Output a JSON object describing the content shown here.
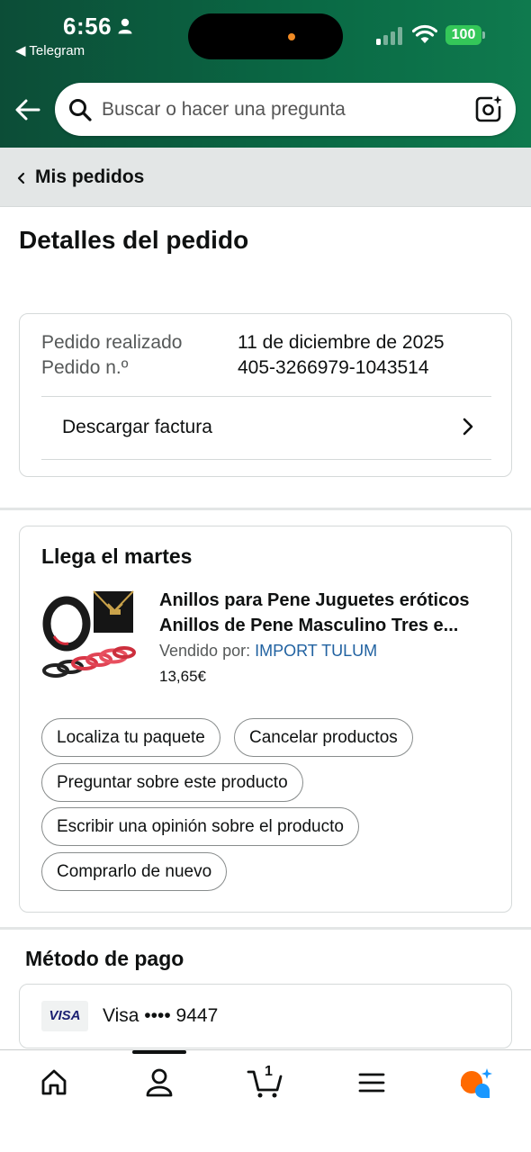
{
  "status_bar": {
    "time": "6:56",
    "back_app": "◀ Telegram",
    "battery": "100"
  },
  "search": {
    "placeholder": "Buscar o hacer una pregunta"
  },
  "breadcrumb": {
    "label": "Mis pedidos"
  },
  "page": {
    "title": "Detalles del pedido"
  },
  "order_info": {
    "placed_label": "Pedido realizado",
    "placed_value": "11 de diciembre de 2025",
    "number_label": "Pedido n.º",
    "number_value": "405-3266979-1043514",
    "invoice_label": "Descargar factura"
  },
  "shipment": {
    "title": "Llega el martes",
    "product_title": "Anillos para Pene Juguetes eróticos Anillos de Pene Masculino Tres e...",
    "seller_prefix": "Vendido por:",
    "seller_name": "IMPORT TULUM",
    "price": "13,65€",
    "actions": [
      "Localiza tu paquete",
      "Cancelar productos",
      "Preguntar sobre este producto",
      "Escribir una opinión sobre el producto",
      "Comprarlo de nuevo"
    ]
  },
  "payment": {
    "title": "Método de pago",
    "card_brand": "VISA",
    "card_text": "Visa •••• 9447"
  },
  "bottom_nav": {
    "cart_count": "1",
    "items": [
      "home-icon",
      "account-icon",
      "cart-icon",
      "menu-icon",
      "rufus-ai-icon"
    ]
  },
  "colors": {
    "header_green": "#0a6a45",
    "link_blue": "#2162a1",
    "battery_green": "#34c759",
    "rufus_orange": "#ff6a00",
    "rufus_blue": "#1a98ff"
  }
}
